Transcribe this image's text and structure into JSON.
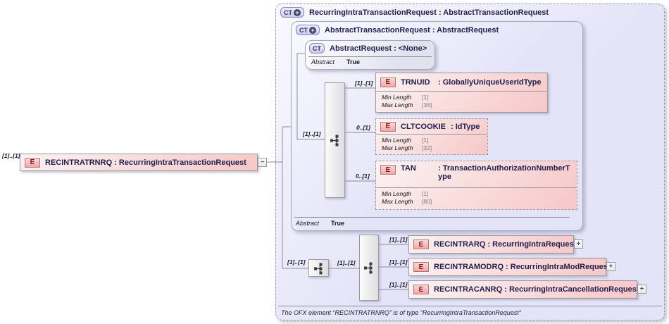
{
  "icons": {
    "element": "E",
    "complex_type": "CT",
    "derive_plus": "+",
    "collapse": "−",
    "expand": "+"
  },
  "root_element": {
    "cardinality": "[1]..[1]",
    "title": "RECINTRATRNRQ : RecurringIntraTransactionRequest"
  },
  "outer_type": {
    "title": "RecurringIntraTransactionRequest : AbstractTransactionRequest",
    "footer": "The OFX element “RECINTRATRNRQ” is of type “RecurringIntraTransactionRequest”"
  },
  "base_type": {
    "title": "AbstractTransactionRequest : AbstractRequest",
    "abstract_label": "Abstract",
    "abstract_value": "True",
    "content_cardinality": "[1]..[1]"
  },
  "root_base_type": {
    "title": "AbstractRequest : <None>",
    "abstract_label": "Abstract",
    "abstract_value": "True"
  },
  "inherited_elements": [
    {
      "cardinality": "[1]..[1]",
      "name": "TRNUID",
      "type": ": GloballyUniqueUserIdType",
      "facets": [
        {
          "label": "Min Length",
          "value": "[1]"
        },
        {
          "label": "Max Length",
          "value": "[36]"
        }
      ]
    },
    {
      "cardinality": "0..[1]",
      "name": "CLTCOOKIE",
      "type": ": IdType",
      "facets": [
        {
          "label": "Min Length",
          "value": "[1]"
        },
        {
          "label": "Max Length",
          "value": "[32]"
        }
      ]
    },
    {
      "cardinality": "0..[1]",
      "name": "TAN",
      "type": ": TransactionAuthorizationNumberType",
      "facets": [
        {
          "label": "Min Length",
          "value": "[1]"
        },
        {
          "label": "Max Length",
          "value": "[80]"
        }
      ]
    }
  ],
  "outer_sequence": {
    "cardinality": "[1]..[1]"
  },
  "element_choice": {
    "cardinality": "[1]..[1]"
  },
  "local_elements": [
    {
      "cardinality": "[1]..[1]",
      "title": "RECINTRARQ : RecurringIntraRequest"
    },
    {
      "cardinality": "[1]..[1]",
      "title": "RECINTRAMODRQ : RecurringIntraModRequest"
    },
    {
      "cardinality": "[1]..[1]",
      "title": "RECINTRACANRQ : RecurringIntraCancellationRequest"
    }
  ],
  "colors": {
    "lavender_fill": "#e6e6f8",
    "pink_fill": "#f6c6c6",
    "border_gray": "#9a9aa2",
    "title_text": "#1f1f4e"
  }
}
